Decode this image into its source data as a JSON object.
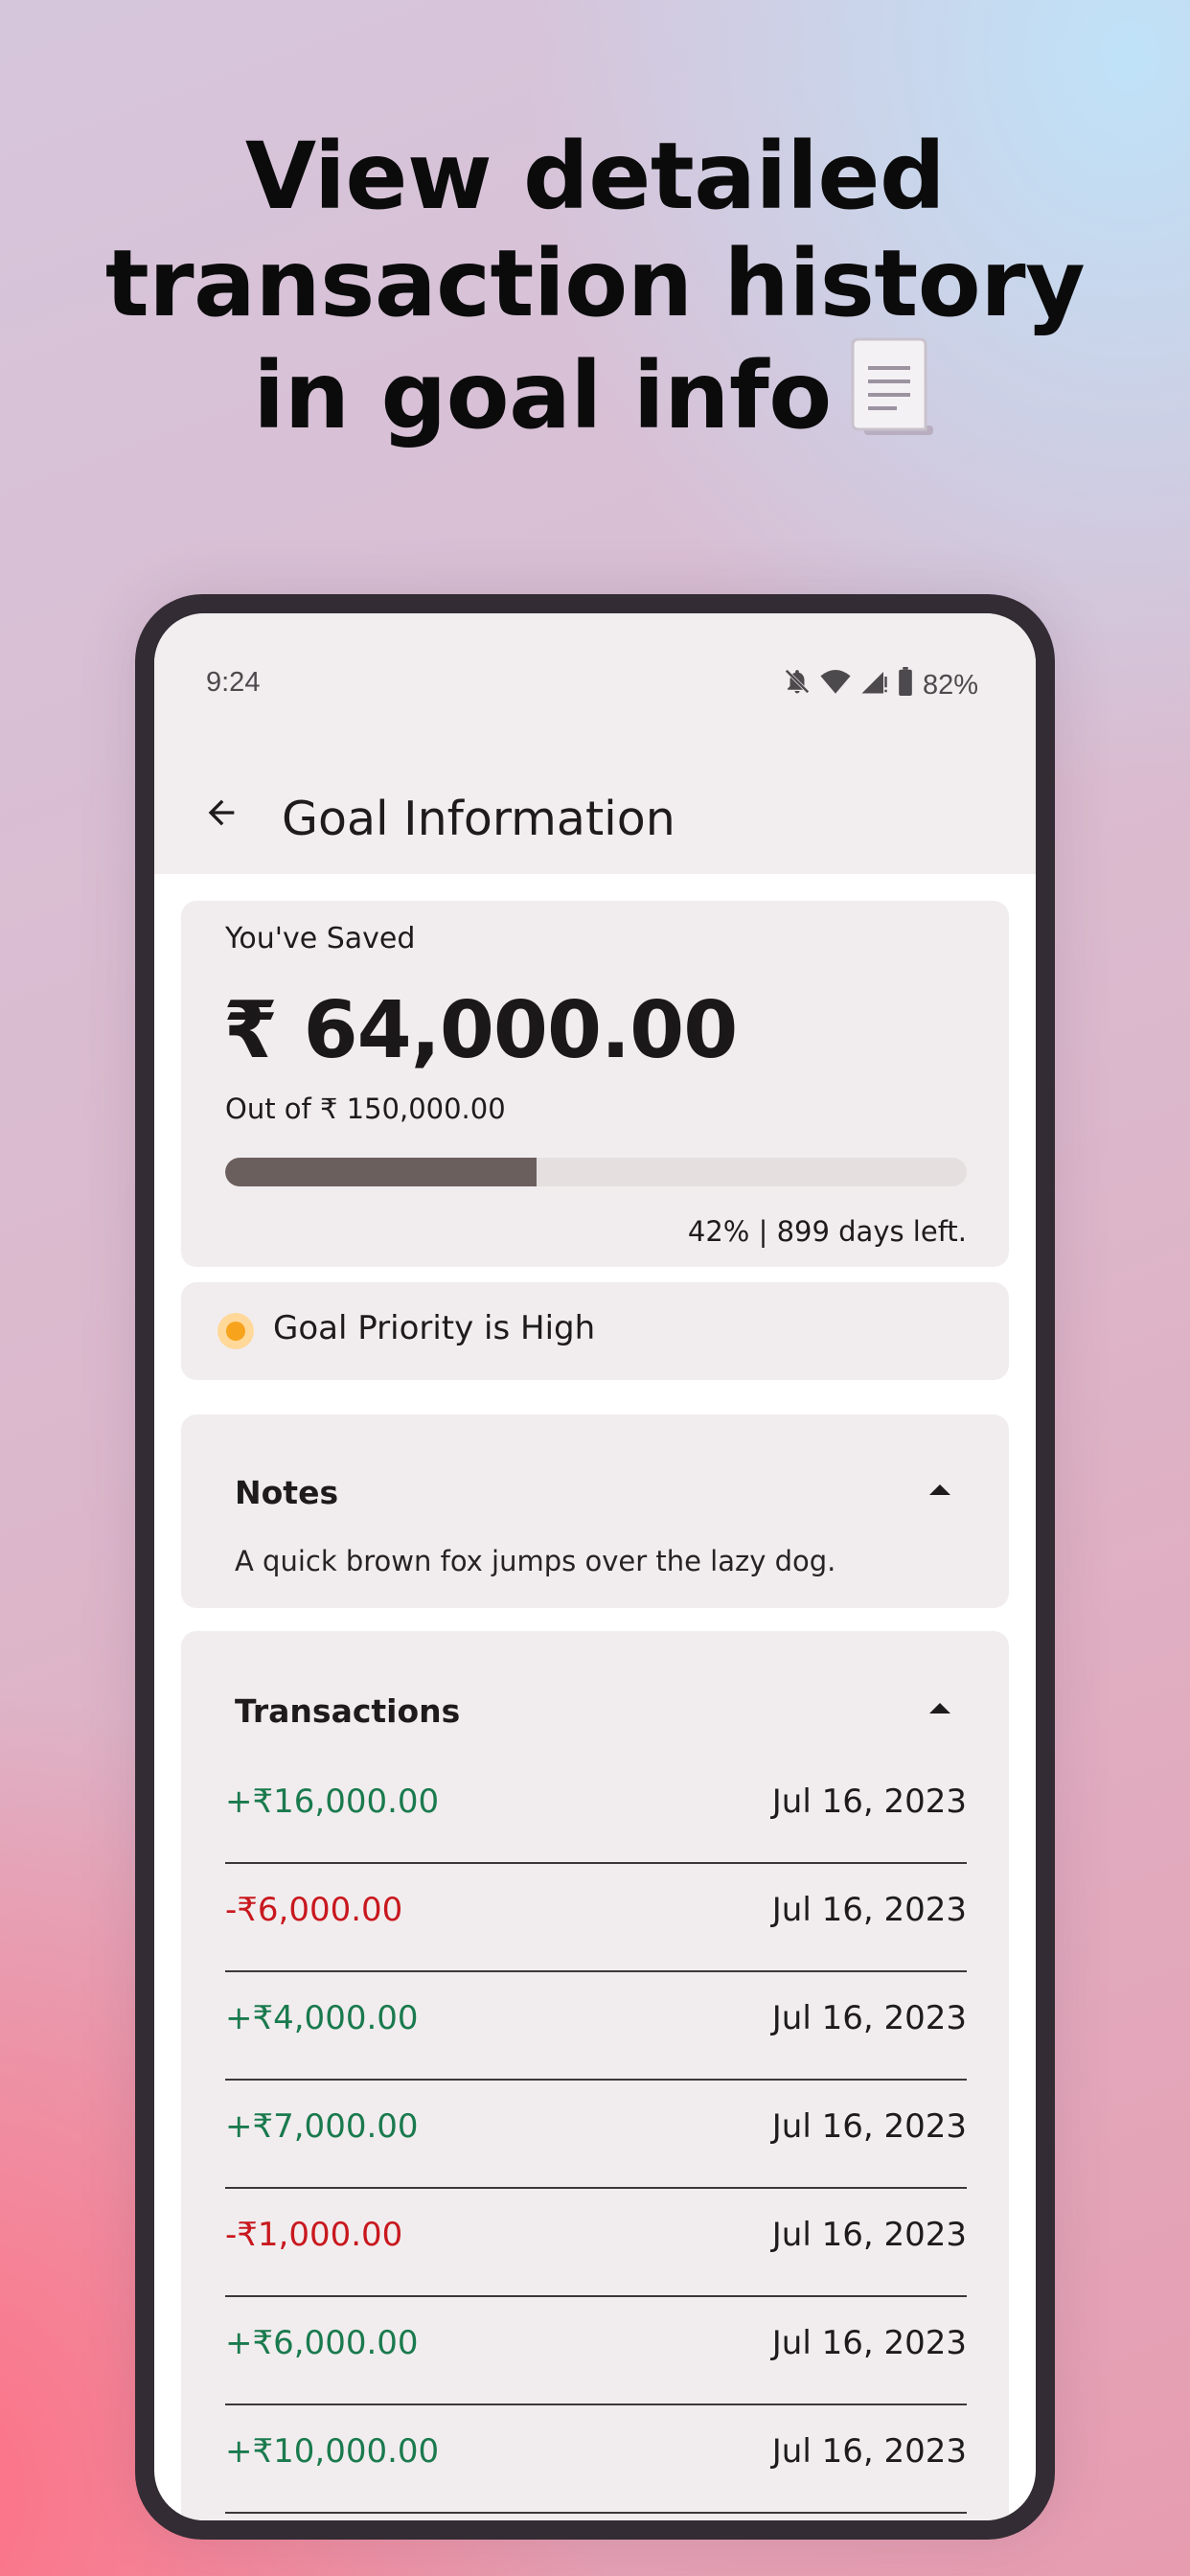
{
  "headline": {
    "line1": "View detailed",
    "line2": "transaction history",
    "line3": "in goal info",
    "icon": "receipt-icon"
  },
  "status_bar": {
    "time": "9:24",
    "battery": "82%",
    "icons": [
      "bell-off-icon",
      "wifi-icon",
      "signal-icon",
      "battery-icon"
    ]
  },
  "app_bar": {
    "title": "Goal Information",
    "back_icon": "arrow-back-icon"
  },
  "savings": {
    "label": "You've Saved",
    "amount": "₹ 64,000.00",
    "target": "Out of ₹ 150,000.00",
    "progress_percent": 42,
    "progress_text": "42% | 899 days left."
  },
  "priority": {
    "text": "Goal Priority is High",
    "color": "#f7a31c"
  },
  "notes": {
    "title": "Notes",
    "body": "A quick brown fox jumps over the lazy dog."
  },
  "transactions": {
    "title": "Transactions",
    "positive_color": "#1a7a4e",
    "negative_color": "#c8181e",
    "items": [
      {
        "amount": "+₹16,000.00",
        "date": "Jul 16, 2023",
        "type": "credit"
      },
      {
        "amount": "-₹6,000.00",
        "date": "Jul 16, 2023",
        "type": "debit"
      },
      {
        "amount": "+₹4,000.00",
        "date": "Jul 16, 2023",
        "type": "credit"
      },
      {
        "amount": "+₹7,000.00",
        "date": "Jul 16, 2023",
        "type": "credit"
      },
      {
        "amount": "-₹1,000.00",
        "date": "Jul 16, 2023",
        "type": "debit"
      },
      {
        "amount": "+₹6,000.00",
        "date": "Jul 16, 2023",
        "type": "credit"
      },
      {
        "amount": "+₹10,000.00",
        "date": "Jul 16, 2023",
        "type": "credit"
      }
    ]
  }
}
